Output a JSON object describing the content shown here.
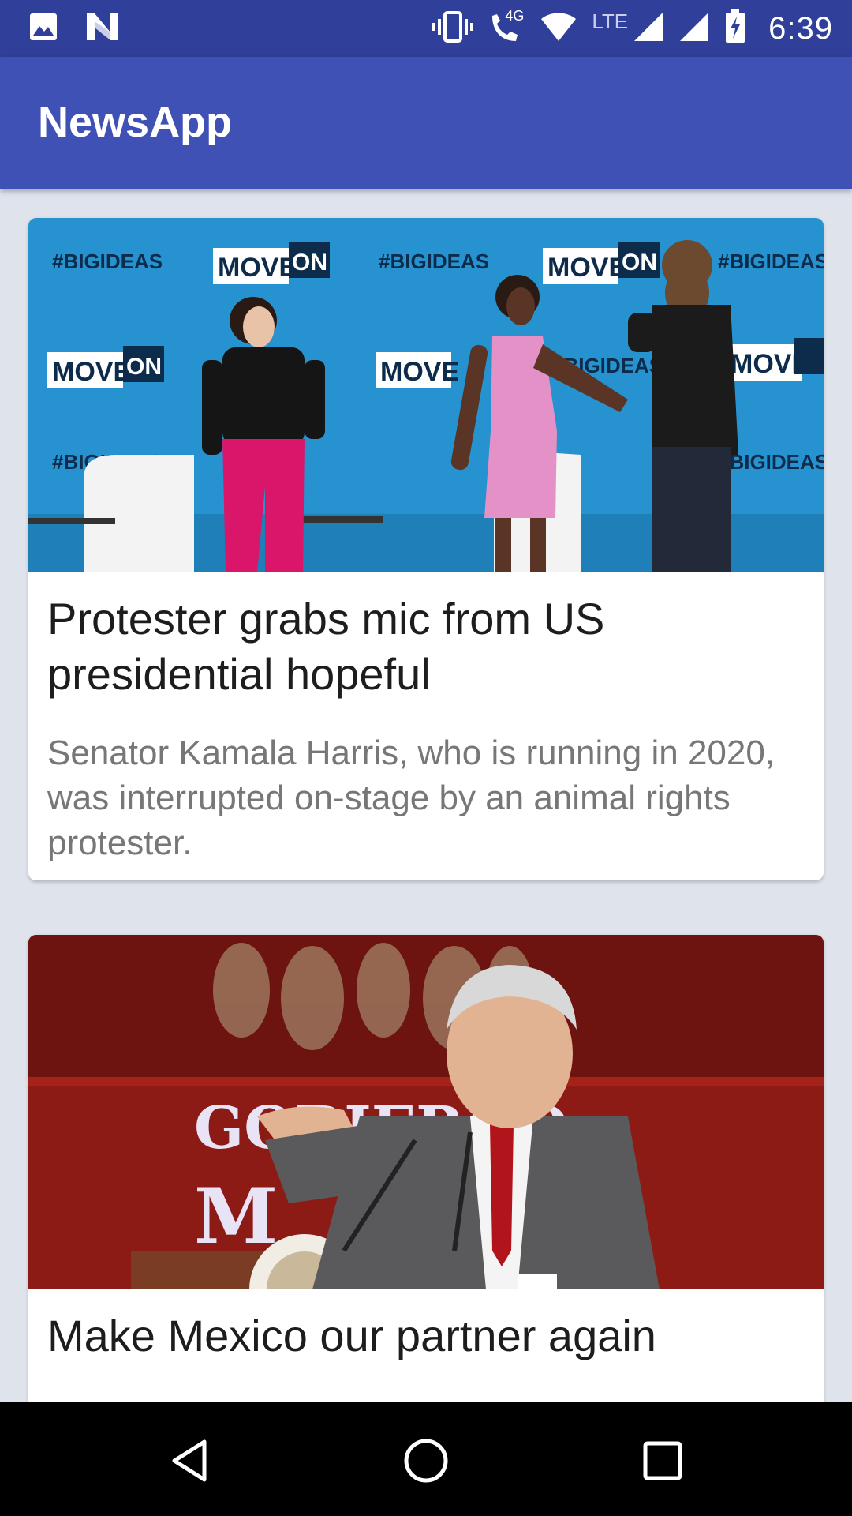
{
  "status_bar": {
    "time": "6:39",
    "network_label": "LTE",
    "data_label": "4G",
    "icons_left": [
      "image-notification-icon",
      "news-app-notification-icon"
    ],
    "icons_right": [
      "vibrate-icon",
      "volte-call-icon",
      "wifi-icon",
      "signal-lte-icon",
      "signal-icon",
      "battery-charging-icon"
    ]
  },
  "app_bar": {
    "title": "NewsApp"
  },
  "articles": [
    {
      "headline": "Protester grabs mic from US presidential hopeful",
      "summary": "Senator Kamala Harris, who is running in 2020, was interrupted on-stage by an animal rights protester.",
      "image_signage": [
        "#BIGIDEAS",
        "MOVE",
        "ON"
      ]
    },
    {
      "headline": "Make Mexico our partner again",
      "summary": "",
      "image_signage": [
        "GOBIERNO",
        "M"
      ]
    }
  ],
  "nav_bar": {
    "buttons": [
      "back-icon",
      "home-icon",
      "recents-icon"
    ]
  },
  "colors": {
    "status_bar": "#2f3f9a",
    "app_bar": "#3f51b5",
    "background": "#dfe3ec",
    "headline": "#1d1d1d",
    "summary": "#777777"
  }
}
